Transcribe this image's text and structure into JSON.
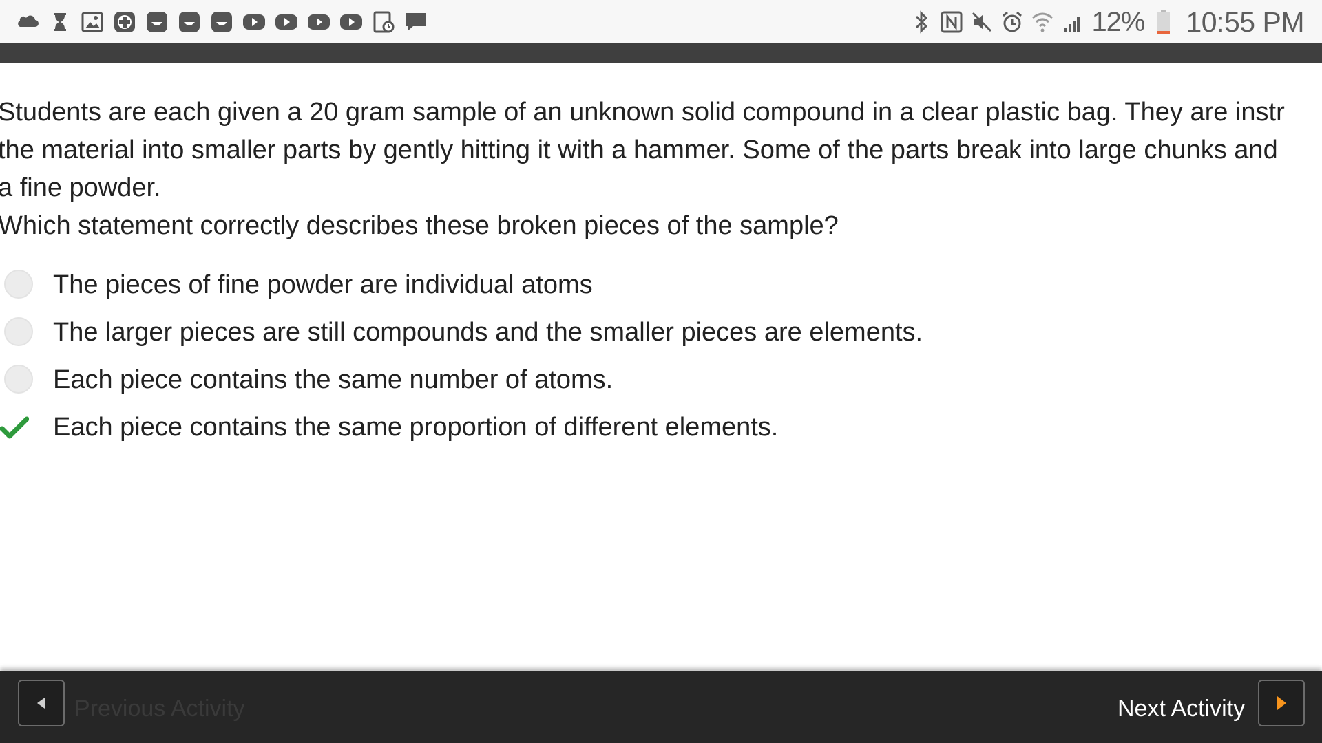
{
  "status_bar": {
    "left_icons": [
      "cloud-icon",
      "hourglass-icon",
      "gallery-icon",
      "plus-icon",
      "app-icon",
      "app-icon",
      "app-icon",
      "youtube-icon",
      "youtube-icon",
      "youtube-icon",
      "youtube-icon",
      "calendar-icon",
      "message-icon"
    ],
    "right_icons": [
      "bluetooth-icon",
      "nfc-icon",
      "mute-icon",
      "alarm-icon",
      "wifi-icon",
      "signal-icon"
    ],
    "battery_percent": "12%",
    "battery_level": 0.12,
    "time": "10:55 PM"
  },
  "question": {
    "lines": [
      "Students are each given a 20 gram sample of an unknown solid compound in a clear plastic bag. They are instr",
      "the material into smaller parts by gently hitting it with a hammer. Some of the parts break into large chunks and",
      "a fine powder."
    ],
    "prompt": "Which statement correctly describes these broken pieces of the sample?"
  },
  "options": [
    {
      "label": "The pieces of fine powder are individual atoms",
      "selected": false
    },
    {
      "label": "The larger pieces are still compounds and the smaller pieces are elements.",
      "selected": false
    },
    {
      "label": "Each piece contains the same number of atoms.",
      "selected": false
    },
    {
      "label": "Each piece contains the same proportion of different elements.",
      "selected": true
    }
  ],
  "footer": {
    "previous_label": "Previous Activity",
    "next_label": "Next Activity"
  },
  "colors": {
    "check": "#2e9a3c",
    "next_arrow": "#f7941d",
    "battery": "#e8663d"
  }
}
